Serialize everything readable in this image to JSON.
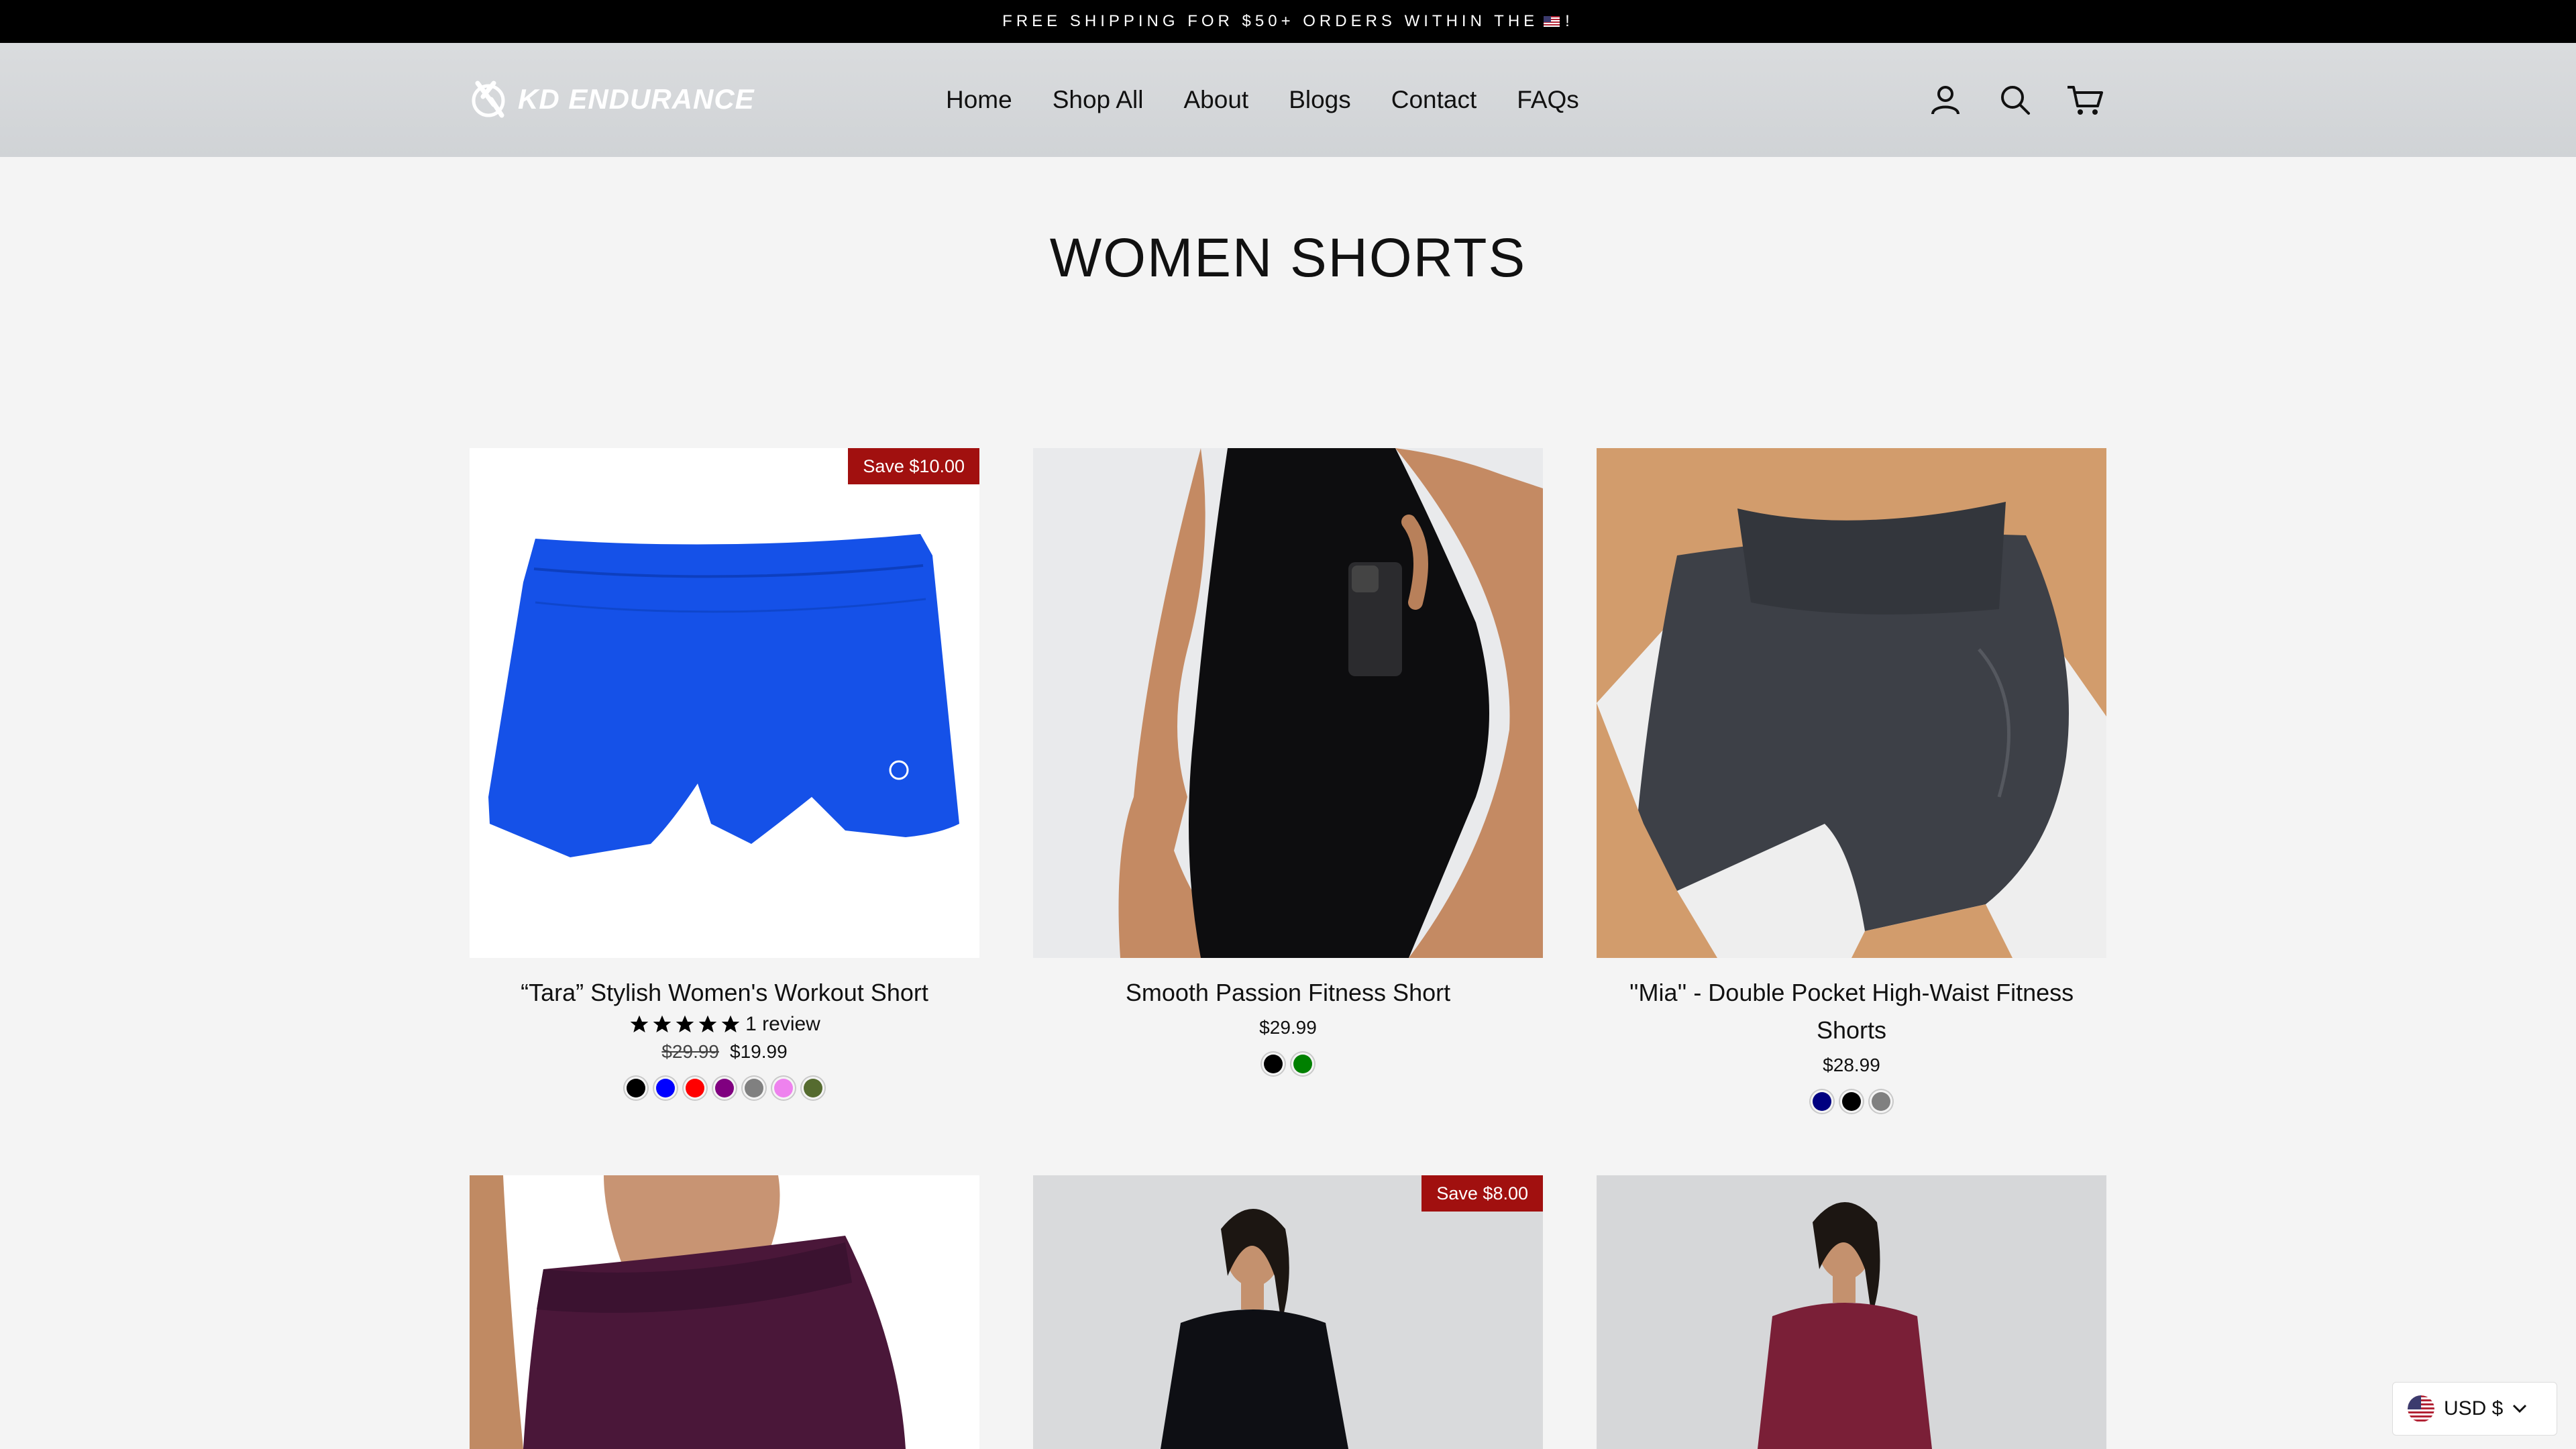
{
  "announcement": {
    "text_before": "FREE SHIPPING FOR $50+ ORDERS WITHIN THE",
    "text_after": "!"
  },
  "header": {
    "logo_text": "KD ENDURANCE",
    "nav": [
      "Home",
      "Shop All",
      "About",
      "Blogs",
      "Contact",
      "FAQs"
    ],
    "icons": [
      "account-icon",
      "search-icon",
      "cart-icon"
    ]
  },
  "page": {
    "title": "WOMEN SHORTS"
  },
  "products": [
    {
      "badge": "Save $10.00",
      "name": "“Tara” Stylish Women's Workout Short",
      "rating": 5,
      "reviews": "1 review",
      "old_price": "$29.99",
      "price": "$19.99",
      "swatches": [
        "#000000",
        "#0000ff",
        "#ff0000",
        "#800080",
        "#808080",
        "#ee82ee",
        "#556b2f"
      ]
    },
    {
      "badge": "",
      "name": "Smooth Passion Fitness Short",
      "price": "$29.99",
      "swatches": [
        "#000000",
        "#008000"
      ]
    },
    {
      "badge": "",
      "name": "''Mia'' - Double Pocket High-Waist Fitness Shorts",
      "price": "$28.99",
      "swatches": [
        "#000080",
        "#000000",
        "#808080"
      ]
    },
    {
      "badge": ""
    },
    {
      "badge": "Save $8.00"
    },
    {
      "badge": ""
    }
  ],
  "currency": {
    "label": "USD $"
  },
  "colors": {
    "sale_badge": "#a1100f",
    "header_bg": "#d5d8db",
    "page_bg": "#f4f4f4"
  }
}
